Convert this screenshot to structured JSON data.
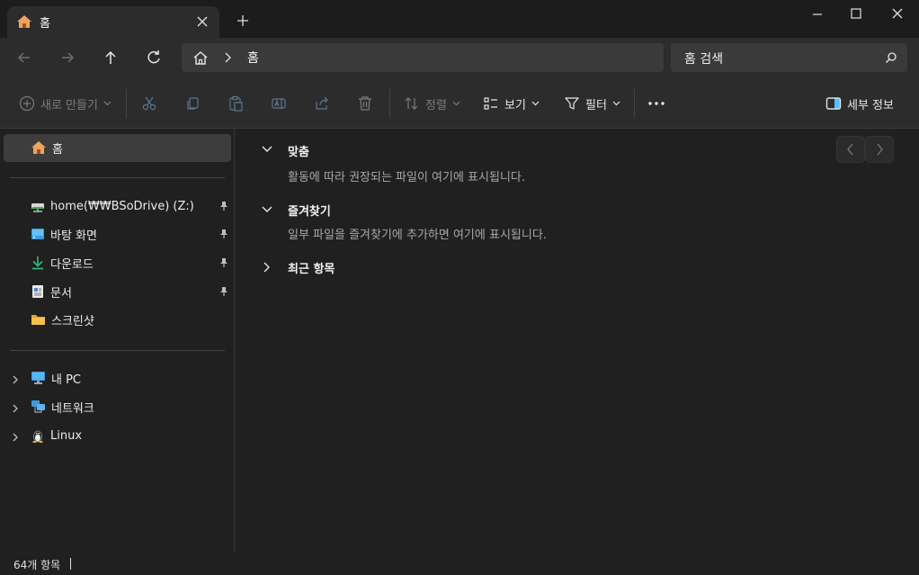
{
  "tab": {
    "label": "홈",
    "new_tab": "+"
  },
  "address": {
    "current": "홈"
  },
  "search": {
    "placeholder": "홈 검색"
  },
  "toolbar": {
    "new_label": "새로 만들기",
    "sort_label": "정렬",
    "view_label": "보기",
    "filter_label": "필터",
    "details_label": "세부 정보"
  },
  "sidebar": {
    "home": "홈",
    "pinned": [
      {
        "label": "home(₩₩BSoDrive) (Z:)",
        "icon": "network-drive-icon"
      },
      {
        "label": "바탕 화면",
        "icon": "desktop-icon"
      },
      {
        "label": "다운로드",
        "icon": "download-icon"
      },
      {
        "label": "문서",
        "icon": "document-icon"
      },
      {
        "label": "스크린샷",
        "icon": "folder-icon"
      }
    ],
    "locations": [
      {
        "label": "내 PC",
        "icon": "pc-icon"
      },
      {
        "label": "네트워크",
        "icon": "network-icon"
      },
      {
        "label": "Linux",
        "icon": "linux-icon"
      }
    ]
  },
  "main": {
    "groups": [
      {
        "title": "맞춤",
        "desc": "활동에 따라 권장되는 파일이 여기에 표시됩니다."
      },
      {
        "title": "즐겨찾기",
        "desc": "일부 파일을 즐겨찾기에 추가하면 여기에 표시됩니다."
      },
      {
        "title": "최근 항목"
      }
    ]
  },
  "status": {
    "count": "64개 항목"
  },
  "colors": {
    "accent": "#4cc2ff",
    "folder": "#f2c14e",
    "home_icon": "#f0a35e"
  }
}
